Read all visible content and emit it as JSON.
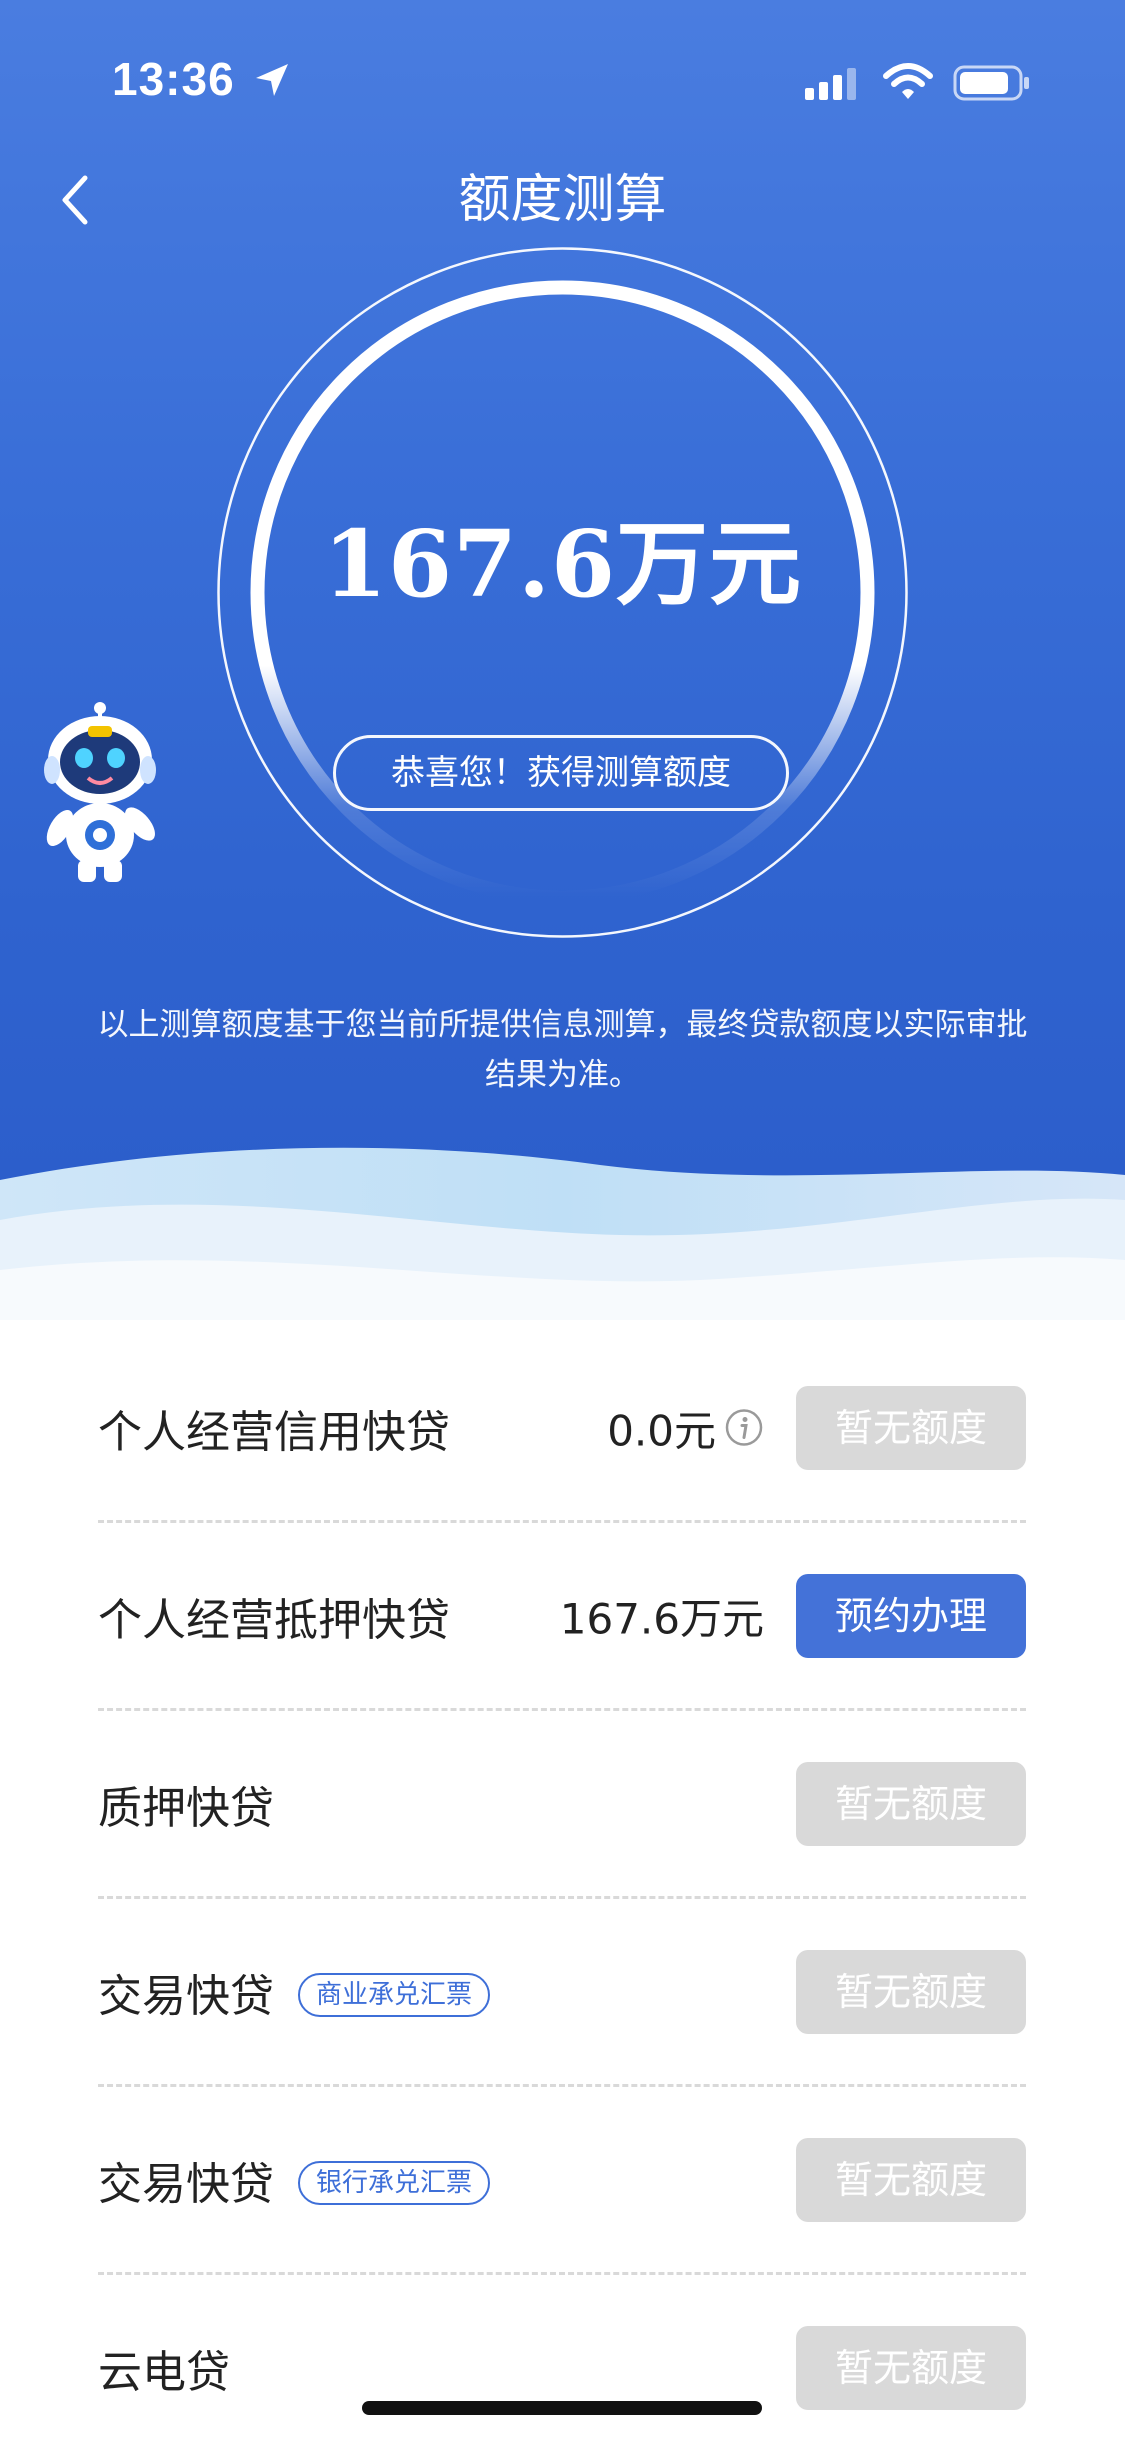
{
  "status_bar": {
    "time": "13:36"
  },
  "nav": {
    "title": "额度测算",
    "back_icon": "chevron-left-icon"
  },
  "result": {
    "amount": "167.6万元",
    "congrats": "恭喜您！获得测算额度",
    "disclaimer_line1": "以上测算额度基于您当前所提供信息测算，最终贷款额度以实际审批",
    "disclaimer_line2": "结果为准。"
  },
  "colors": {
    "primary": "#4472d8",
    "hero_top": "#4a7de0",
    "hero_bottom": "#2b5cc9",
    "disabled": "#d9d9d9",
    "tag_blue": "#3e6fd8"
  },
  "products": [
    {
      "name": "个人经营信用快贷",
      "tag": "",
      "amount": "0.0元",
      "has_info": true,
      "button": "暂无额度",
      "enabled": false
    },
    {
      "name": "个人经营抵押快贷",
      "tag": "",
      "amount": "167.6万元",
      "has_info": false,
      "button": "预约办理",
      "enabled": true
    },
    {
      "name": "质押快贷",
      "tag": "",
      "amount": "",
      "has_info": false,
      "button": "暂无额度",
      "enabled": false
    },
    {
      "name": "交易快贷",
      "tag": "商业承兑汇票",
      "amount": "",
      "has_info": false,
      "button": "暂无额度",
      "enabled": false
    },
    {
      "name": "交易快贷",
      "tag": "银行承兑汇票",
      "amount": "",
      "has_info": false,
      "button": "暂无额度",
      "enabled": false
    },
    {
      "name": "云电贷",
      "tag": "",
      "amount": "",
      "has_info": false,
      "button": "暂无额度",
      "enabled": false
    }
  ]
}
